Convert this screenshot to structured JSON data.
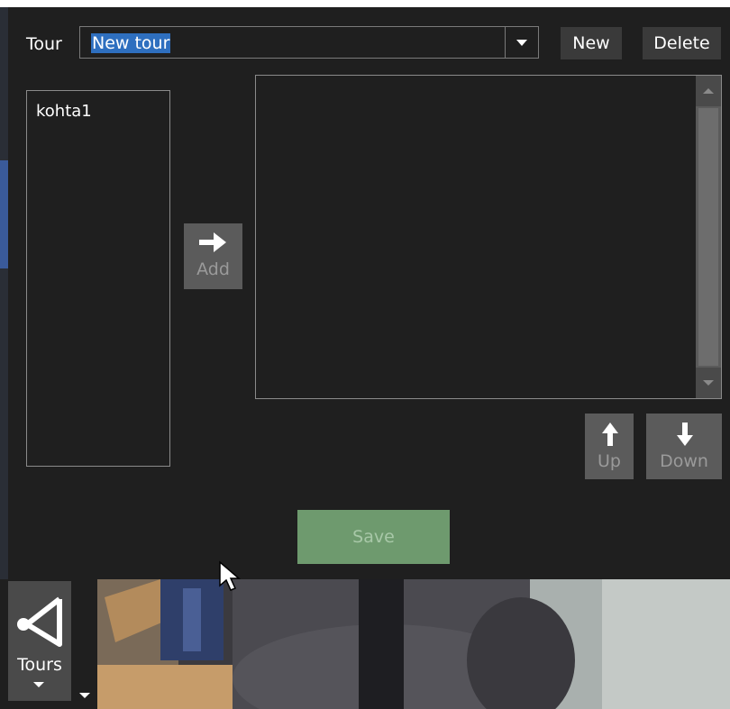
{
  "dialog": {
    "tour_label": "Tour",
    "tour_select": {
      "value": "New tour"
    },
    "new_button": "New",
    "delete_button": "Delete",
    "available_items": [
      "kohta1"
    ],
    "add_button": "Add",
    "tour_items": [],
    "up_button": "Up",
    "down_button": "Down",
    "save_button": "Save"
  },
  "toolbar": {
    "tours_button": "Tours"
  },
  "icons": {
    "add": "arrow-right-icon",
    "up": "arrow-up-icon",
    "down": "arrow-down-icon",
    "tours": "tour-path-icon",
    "dropdown": "caret-down-icon"
  },
  "colors": {
    "panel_bg": "#1f1f1f",
    "selection": "#2e6fbf",
    "save_button": "#6e9a6e",
    "disabled_button": "#5b5b5b"
  }
}
